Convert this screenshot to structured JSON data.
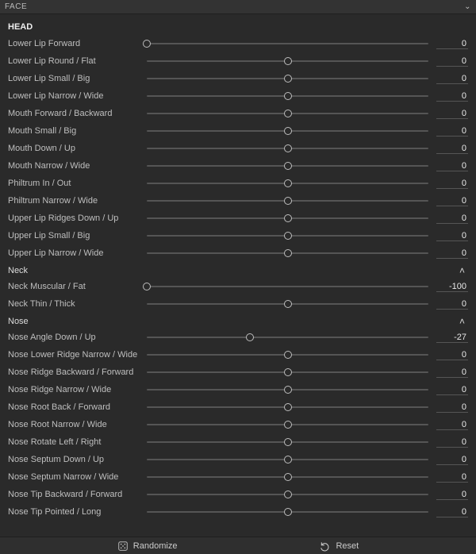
{
  "topbar": {
    "title": "FACE"
  },
  "section_head": {
    "label": "HEAD",
    "rows": [
      {
        "label": "Lower Lip Forward",
        "value": 0,
        "pos": 0
      },
      {
        "label": "Lower Lip Round / Flat",
        "value": 0,
        "pos": 50
      },
      {
        "label": "Lower Lip Small / Big",
        "value": 0,
        "pos": 50
      },
      {
        "label": "Lower Lip Narrow / Wide",
        "value": 0,
        "pos": 50
      },
      {
        "label": "Mouth Forward / Backward",
        "value": 0,
        "pos": 50
      },
      {
        "label": "Mouth Small / Big",
        "value": 0,
        "pos": 50
      },
      {
        "label": "Mouth Down / Up",
        "value": 0,
        "pos": 50
      },
      {
        "label": "Mouth Narrow / Wide",
        "value": 0,
        "pos": 50
      },
      {
        "label": "Philtrum In / Out",
        "value": 0,
        "pos": 50
      },
      {
        "label": "Philtrum Narrow / Wide",
        "value": 0,
        "pos": 50
      },
      {
        "label": "Upper Lip Ridges Down / Up",
        "value": 0,
        "pos": 50
      },
      {
        "label": "Upper Lip Small / Big",
        "value": 0,
        "pos": 50
      },
      {
        "label": "Upper Lip Narrow / Wide",
        "value": 0,
        "pos": 50
      }
    ]
  },
  "section_neck": {
    "label": "Neck",
    "rows": [
      {
        "label": "Neck Muscular / Fat",
        "value": -100,
        "pos": 0
      },
      {
        "label": "Neck Thin / Thick",
        "value": 0,
        "pos": 50
      }
    ]
  },
  "section_nose": {
    "label": "Nose",
    "rows": [
      {
        "label": "Nose Angle Down / Up",
        "value": -27,
        "pos": 36.5
      },
      {
        "label": "Nose Lower Ridge Narrow / Wide",
        "value": 0,
        "pos": 50
      },
      {
        "label": "Nose Ridge Backward / Forward",
        "value": 0,
        "pos": 50
      },
      {
        "label": "Nose Ridge Narrow / Wide",
        "value": 0,
        "pos": 50
      },
      {
        "label": "Nose Root Back / Forward",
        "value": 0,
        "pos": 50
      },
      {
        "label": "Nose Root Narrow / Wide",
        "value": 0,
        "pos": 50
      },
      {
        "label": "Nose Rotate Left / Right",
        "value": 0,
        "pos": 50
      },
      {
        "label": "Nose Septum Down / Up",
        "value": 0,
        "pos": 50
      },
      {
        "label": "Nose Septum Narrow / Wide",
        "value": 0,
        "pos": 50
      },
      {
        "label": "Nose Tip Backward / Forward",
        "value": 0,
        "pos": 50
      },
      {
        "label": "Nose Tip Pointed / Long",
        "value": 0,
        "pos": 50
      }
    ]
  },
  "footer": {
    "randomize": "Randomize",
    "reset": "Reset"
  }
}
